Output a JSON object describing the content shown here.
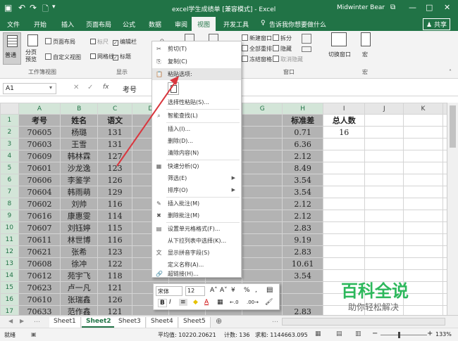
{
  "titlebar": {
    "title": "excel学生成绩单 [兼容模式] - Excel",
    "user": "Midwinter Bear",
    "min": "—",
    "max": "□",
    "close": "✕",
    "save_icon": "save-icon",
    "undo": "↶",
    "redo": "↷",
    "file_new": "🗋",
    "qa_more": "▾",
    "restore": "⧉"
  },
  "tabs": {
    "items": [
      "文件",
      "开始",
      "插入",
      "页面布局",
      "公式",
      "数据",
      "审阅",
      "视图",
      "开发工具"
    ],
    "active": "视图",
    "tell": "告诉我你想要做什么",
    "share": "共享"
  },
  "ribbon": {
    "views": {
      "normal": "普通",
      "pagebreak": "分页\n预览",
      "pagelayout": "页面布局",
      "custom": "自定义视图",
      "group": "工作簿视图"
    },
    "show": {
      "ruler": "标尺",
      "editbar": "编辑栏",
      "grid": "网格线",
      "headings": "标题",
      "group": "显示"
    },
    "window": {
      "new": "新建窗口",
      "arrange": "全部重排",
      "freeze": "冻结窗格",
      "split": "拆分",
      "hide": "隐藏",
      "unhide": "取消隐藏",
      "switch": "切换窗口",
      "macro": "宏",
      "group": "窗口",
      "macro_group": "宏"
    }
  },
  "formula": {
    "cell": "A1",
    "value": "考号",
    "fx": "fx",
    "cancel": "✕",
    "ok": "✓"
  },
  "grid": {
    "cols": [
      "A",
      "B",
      "C",
      "D",
      "E",
      "F",
      "G",
      "H",
      "I",
      "J",
      "K",
      "L"
    ],
    "rows": [
      [
        "考号",
        "姓名",
        "语文",
        "",
        "",
        "",
        "",
        "标准差",
        "总人数",
        "",
        "",
        ""
      ],
      [
        "70605",
        "杨璐",
        "131",
        "",
        "",
        "",
        "",
        "0.71",
        "16",
        "",
        "",
        ""
      ],
      [
        "70603",
        "王雪",
        "131",
        "",
        "",
        "",
        "",
        "6.36",
        "",
        "",
        "",
        ""
      ],
      [
        "70609",
        "韩林霖",
        "127",
        "",
        "",
        "",
        "",
        "2.12",
        "",
        "",
        "",
        ""
      ],
      [
        "70601",
        "沙龙逸",
        "123",
        "",
        "",
        "",
        "",
        "8.49",
        "",
        "",
        "",
        ""
      ],
      [
        "70606",
        "李鉴学",
        "126",
        "",
        "",
        "",
        "",
        "3.54",
        "",
        "",
        "",
        ""
      ],
      [
        "70604",
        "韩雨萌",
        "129",
        "",
        "",
        "",
        "",
        "3.54",
        "",
        "",
        "",
        ""
      ],
      [
        "70602",
        "刘帅",
        "116",
        "",
        "",
        "",
        "",
        "2.12",
        "",
        "",
        "",
        ""
      ],
      [
        "70616",
        "康惠雯",
        "114",
        "",
        "",
        "",
        "",
        "2.12",
        "",
        "",
        "",
        ""
      ],
      [
        "70607",
        "刘钰婷",
        "115",
        "",
        "",
        "",
        "",
        "2.83",
        "",
        "",
        "",
        ""
      ],
      [
        "70611",
        "林世博",
        "116",
        "",
        "",
        "",
        "",
        "9.19",
        "",
        "",
        "",
        ""
      ],
      [
        "70621",
        "张希",
        "123",
        "",
        "",
        "",
        "",
        "2.83",
        "",
        "",
        "",
        ""
      ],
      [
        "70608",
        "徐冲",
        "122",
        "",
        "",
        "",
        "",
        "10.61",
        "",
        "",
        "",
        ""
      ],
      [
        "70612",
        "苑宇飞",
        "118",
        "",
        "",
        "",
        "",
        "3.54",
        "",
        "",
        "",
        ""
      ],
      [
        "70623",
        "卢一凡",
        "121",
        "",
        "",
        "",
        "",
        "",
        "",
        "",
        "",
        ""
      ],
      [
        "70610",
        "张瑞鑫",
        "126",
        "",
        "",
        "",
        "",
        "",
        "",
        "",
        "",
        ""
      ],
      [
        "70633",
        "范作鑫",
        "121",
        "",
        "",
        "",
        "",
        "2.83",
        "",
        "",
        "",
        ""
      ]
    ]
  },
  "menu": {
    "items": [
      "剪切(T)",
      "复制(C)",
      "粘贴选项:",
      "",
      "选择性粘贴(S)...",
      "智能查找(L)",
      "插入(I)...",
      "删除(D)...",
      "清除内容(N)",
      "快速分析(Q)",
      "筛选(E)",
      "排序(O)",
      "插入批注(M)",
      "删除批注(M)",
      "设置单元格格式(F)...",
      "从下拉列表中选择(K)...",
      "显示拼音字段(S)",
      "定义名称(A)...",
      "超链接(H)..."
    ],
    "icons": [
      "✂",
      "⎘",
      "📋",
      "",
      "",
      "⌕",
      "",
      "",
      "",
      "▦",
      "",
      "",
      "✎",
      "✖",
      "▤",
      "",
      "文",
      "",
      "🔗"
    ]
  },
  "mini": {
    "font": "宋体",
    "size": "12",
    "bold": "B",
    "italic": "I",
    "align": "≡",
    "fill": "◆",
    "color": "A",
    "border": "▦",
    "grow": "A˄",
    "shrink": "A˅",
    "money": "¥",
    "percent": "%",
    "comma": ",",
    "inc": "←.0",
    "dec": ".00→",
    "paint": "🖌",
    "table": "▤"
  },
  "sheets": {
    "items": [
      "Sheet1",
      "Sheet2",
      "Sheet3",
      "Sheet4",
      "Sheet5"
    ],
    "active": "Sheet2",
    "add": "⊕",
    "nav_left": "◀",
    "nav_right": "▶",
    "more": "…"
  },
  "status": {
    "ready": "就绪",
    "avg": "平均值: 10220.20621",
    "count": "计数: 136",
    "sum": "求和: 1144663.095",
    "zoom": "133%",
    "minus": "−",
    "plus": "+"
  },
  "watermark": {
    "title": "百科全说",
    "sub": "助你轻松解决"
  },
  "colors": {
    "accent": "#217346",
    "arrow": "#d9363e"
  }
}
